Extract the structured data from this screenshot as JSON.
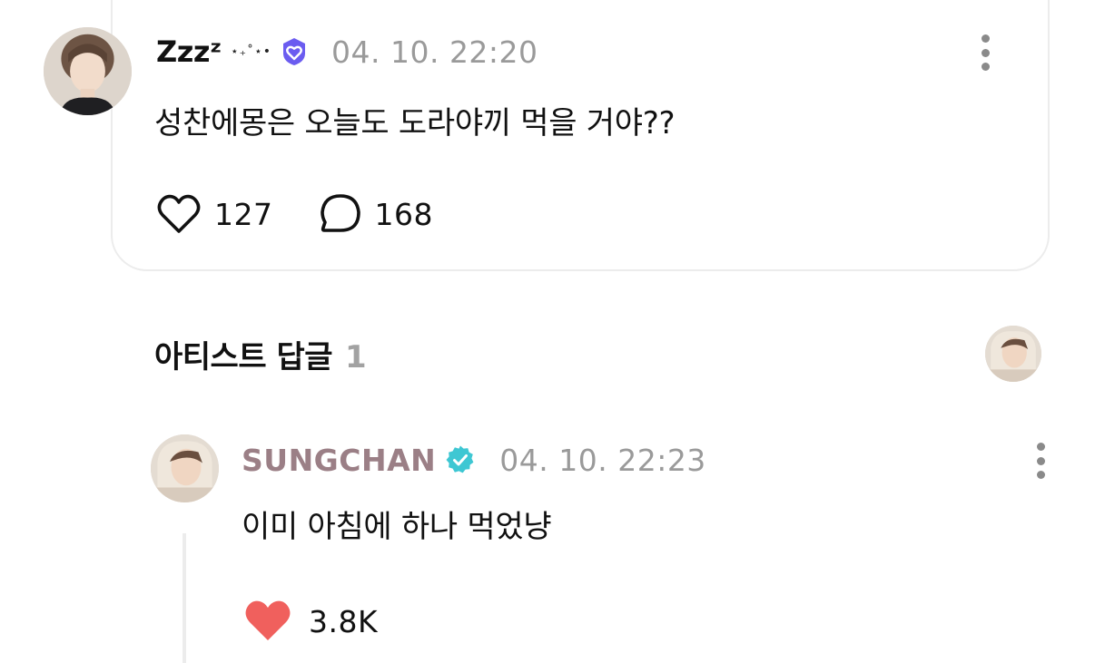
{
  "post": {
    "username": "Zᴢzᶻ",
    "username_deco": "⋆₊˚⋆•",
    "badge_icon": "heart-shield-badge-icon",
    "badge_color": "#6b5cf0",
    "timestamp": "04. 10. 22:20",
    "text": "성찬에몽은 오늘도 도라야끼 먹을 거야??",
    "like_count": "127",
    "comment_count": "168",
    "like_icon": "heart-outline-icon",
    "comment_icon": "speech-bubble-icon",
    "more_icon": "more-vertical-icon"
  },
  "artist_replies": {
    "title": "아티스트 답글",
    "count": "1"
  },
  "reply": {
    "username": "SUNGCHAN",
    "username_color": "#9b7f86",
    "verified_icon": "verified-check-icon",
    "verified_color": "#3ec7d3",
    "timestamp": "04. 10. 22:23",
    "text": "이미 아침에 하나 먹었냥",
    "like_count": "3.8K",
    "like_icon": "heart-filled-icon",
    "like_color": "#f0605d",
    "more_icon": "more-vertical-icon"
  }
}
